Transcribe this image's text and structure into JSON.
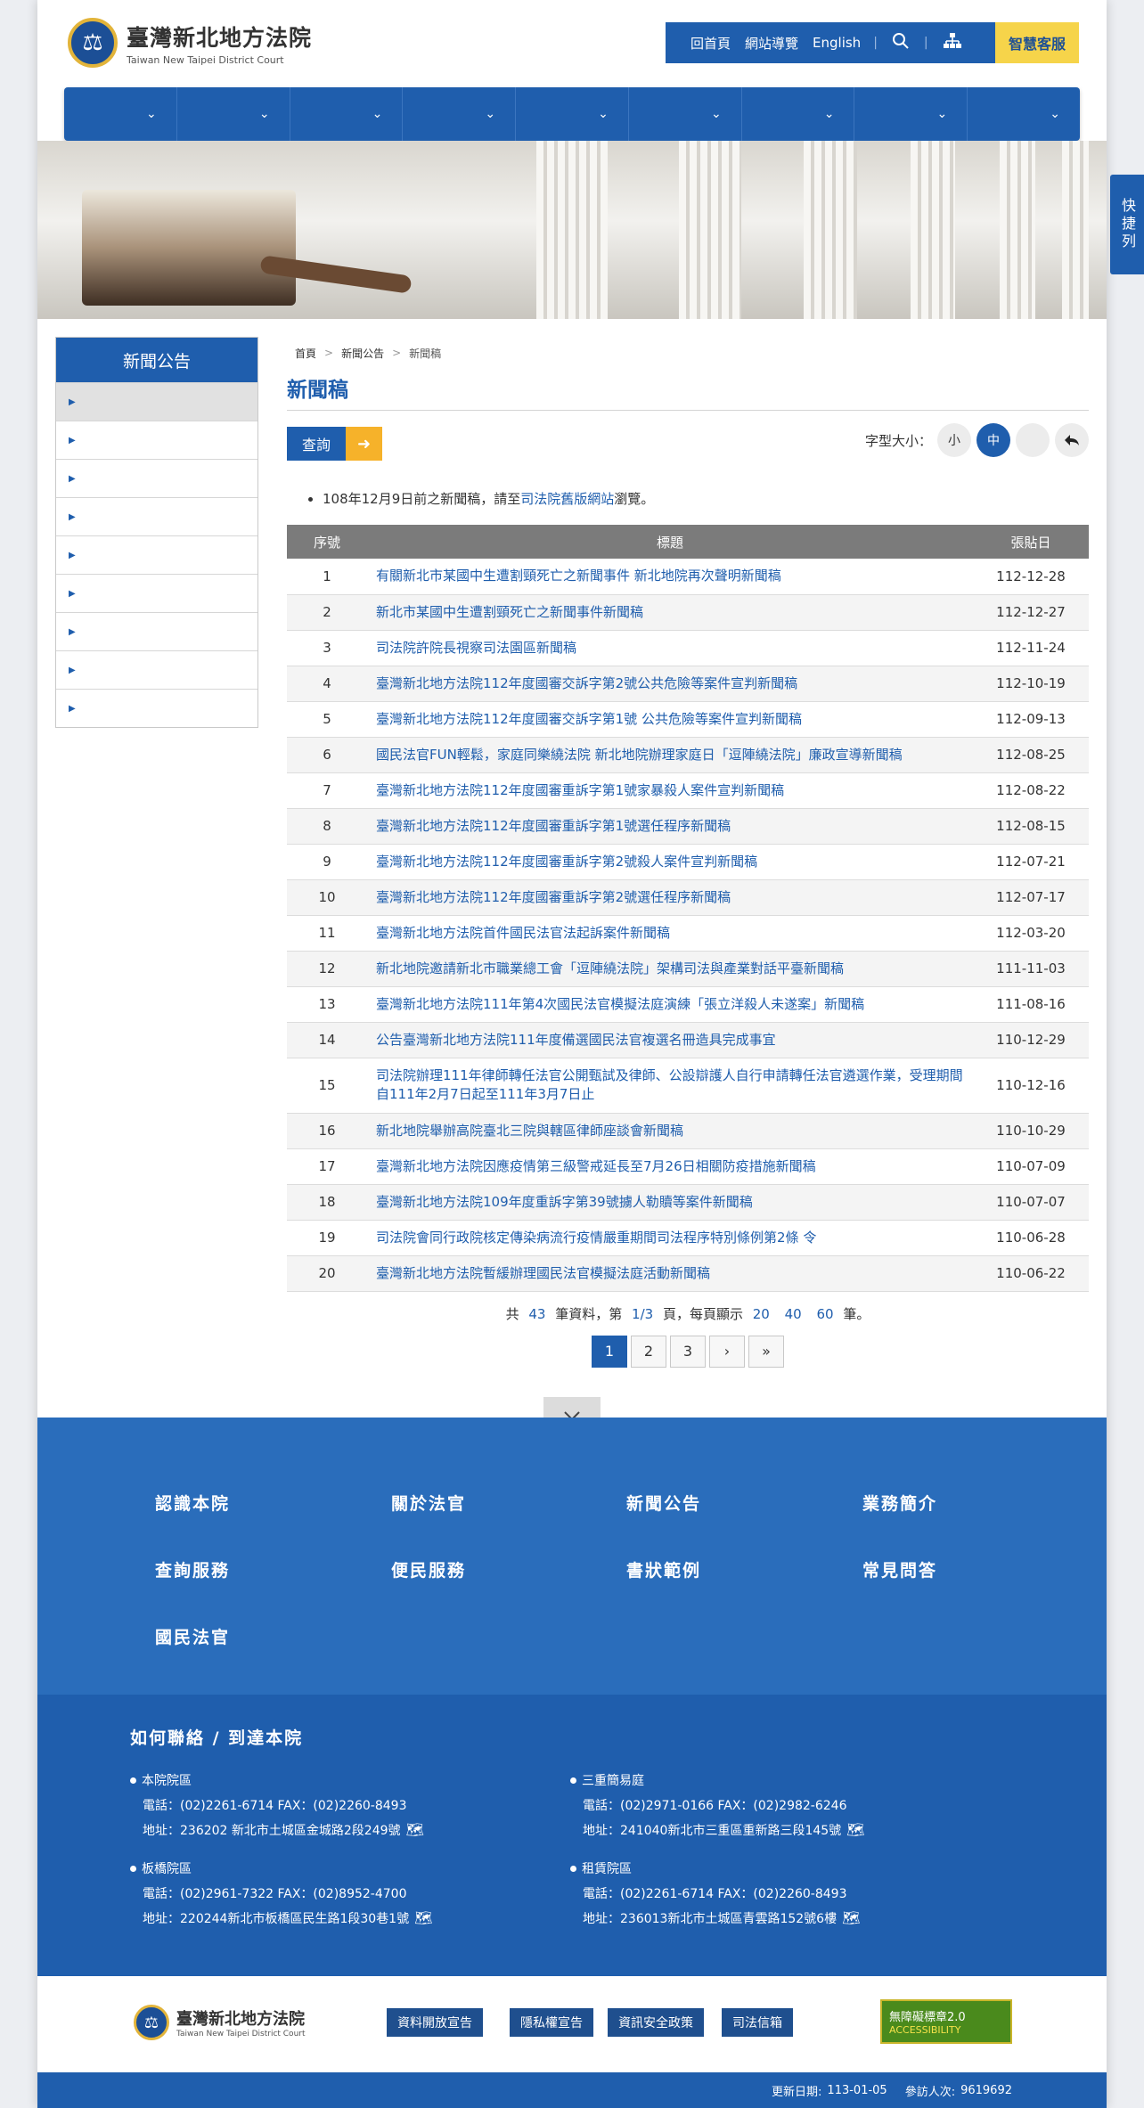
{
  "header": {
    "logo_cn": "臺灣新北地方法院",
    "logo_en": "Taiwan New Taipei District Court",
    "util_links": [
      "回首頁",
      "網站導覽",
      "English"
    ],
    "smart_service": "智慧客服",
    "quick_tab": "快捷列"
  },
  "sidebar": {
    "title": "新聞公告",
    "items": [
      "",
      "",
      "",
      "",
      "",
      "",
      "",
      "",
      ""
    ]
  },
  "breadcrumb": [
    "首頁",
    "新聞公告",
    "新聞稿"
  ],
  "page_title": "新聞稿",
  "toolbar": {
    "query_label": "查詢",
    "fontsize_label": "字型大小：",
    "fs_small": "小",
    "fs_medium": "中"
  },
  "notice": {
    "prefix": "108年12月9日前之新聞稿，請至",
    "link": "司法院舊版網站",
    "suffix": "瀏覽。"
  },
  "table": {
    "headers": [
      "序號",
      "標題",
      "張貼日"
    ],
    "rows": [
      {
        "no": "1",
        "title": "有關新北市某國中生遭割頸死亡之新聞事件 新北地院再次聲明新聞稿",
        "date": "112-12-28"
      },
      {
        "no": "2",
        "title": "新北市某國中生遭割頸死亡之新聞事件新聞稿",
        "date": "112-12-27"
      },
      {
        "no": "3",
        "title": "司法院許院長視察司法園區新聞稿",
        "date": "112-11-24"
      },
      {
        "no": "4",
        "title": "臺灣新北地方法院112年度國審交訴字第2號公共危險等案件宣判新聞稿",
        "date": "112-10-19"
      },
      {
        "no": "5",
        "title": "臺灣新北地方法院112年度國審交訴字第1號 公共危險等案件宣判新聞稿",
        "date": "112-09-13"
      },
      {
        "no": "6",
        "title": "國民法官FUN輕鬆，家庭同樂繞法院 新北地院辦理家庭日「逗陣繞法院」廉政宣導新聞稿",
        "date": "112-08-25"
      },
      {
        "no": "7",
        "title": "臺灣新北地方法院112年度國審重訴字第1號家暴殺人案件宣判新聞稿",
        "date": "112-08-22"
      },
      {
        "no": "8",
        "title": "臺灣新北地方法院112年度國審重訴字第1號選任程序新聞稿",
        "date": "112-08-15"
      },
      {
        "no": "9",
        "title": "臺灣新北地方法院112年度國審重訴字第2號殺人案件宣判新聞稿",
        "date": "112-07-21"
      },
      {
        "no": "10",
        "title": "臺灣新北地方法院112年度國審重訴字第2號選任程序新聞稿",
        "date": "112-07-17"
      },
      {
        "no": "11",
        "title": "臺灣新北地方法院首件國民法官法起訴案件新聞稿",
        "date": "112-03-20"
      },
      {
        "no": "12",
        "title": "新北地院邀請新北市職業總工會「逗陣繞法院」架構司法與產業對話平臺新聞稿",
        "date": "111-11-03"
      },
      {
        "no": "13",
        "title": "臺灣新北地方法院111年第4次國民法官模擬法庭演練「張立洋殺人未遂案」新聞稿",
        "date": "111-08-16"
      },
      {
        "no": "14",
        "title": "公告臺灣新北地方法院111年度備選國民法官複選名冊造具完成事宜",
        "date": "110-12-29"
      },
      {
        "no": "15",
        "title": "司法院辦理111年律師轉任法官公開甄試及律師、公設辯護人自行申請轉任法官遴選作業，受理期間自111年2月7日起至111年3月7日止",
        "date": "110-12-16"
      },
      {
        "no": "16",
        "title": "新北地院舉辦高院臺北三院與轄區律師座談會新聞稿",
        "date": "110-10-29"
      },
      {
        "no": "17",
        "title": "臺灣新北地方法院因應疫情第三級警戒延長至7月26日相關防疫措施新聞稿",
        "date": "110-07-09"
      },
      {
        "no": "18",
        "title": "臺灣新北地方法院109年度重訴字第39號擄人勒贖等案件新聞稿",
        "date": "110-07-07"
      },
      {
        "no": "19",
        "title": "司法院會同行政院核定傳染病流行疫情嚴重期間司法程序特別條例第2條 令",
        "date": "110-06-28"
      },
      {
        "no": "20",
        "title": "臺灣新北地方法院暫緩辦理國民法官模擬法庭活動新聞稿",
        "date": "110-06-22"
      }
    ]
  },
  "pager": {
    "total_prefix": "共",
    "total": "43",
    "mid1": "筆資料，第",
    "page_of": "1/3",
    "mid2": "頁，每頁顯示",
    "sizes": [
      "20",
      "40",
      "60"
    ],
    "suffix": "筆。",
    "pages": [
      "1",
      "2",
      "3"
    ],
    "next": "›",
    "last": "»"
  },
  "footer_links": [
    "認識本院",
    "關於法官",
    "新聞公告",
    "業務簡介",
    "查詢服務",
    "便民服務",
    "書狀範例",
    "常見問答",
    "國民法官"
  ],
  "contact": {
    "title": "如何聯絡 / 到達本院",
    "branches": [
      {
        "name": "本院院區",
        "phone": "電話：(02)2261-6714 FAX：(02)2260-8493",
        "addr": "地址：236202 新北市土城區金城路2段249號"
      },
      {
        "name": "三重簡易庭",
        "phone": "電話：(02)2971-0166 FAX：(02)2982-6246",
        "addr": "地址：241040新北市三重區重新路三段145號"
      },
      {
        "name": "板橋院區",
        "phone": "電話：(02)2961-7322 FAX：(02)8952-4700",
        "addr": "地址：220244新北市板橋區民生路1段30巷1號"
      },
      {
        "name": "租賃院區",
        "phone": "電話：(02)2261-6714 FAX：(02)2260-8493",
        "addr": "地址：236013新北市土城區青雲路152號6樓"
      }
    ]
  },
  "bottom": {
    "logo_cn": "臺灣新北地方法院",
    "logo_en": "Taiwan New Taipei District Court",
    "policies": [
      "資料開放宣告",
      "隱私權宣告",
      "資訊安全政策",
      "司法信箱"
    ],
    "a11y_line1": "無障礙標章2.0",
    "a11y_line2": "ACCESSIBILITY"
  },
  "status": {
    "updated_label": "更新日期:",
    "updated": "113-01-05",
    "visitors_label": "參訪人次:",
    "visitors": "9619692"
  },
  "colors": {
    "primary": "#1f5ead",
    "accent": "#f6d44a",
    "arrow": "#f6b22a"
  }
}
